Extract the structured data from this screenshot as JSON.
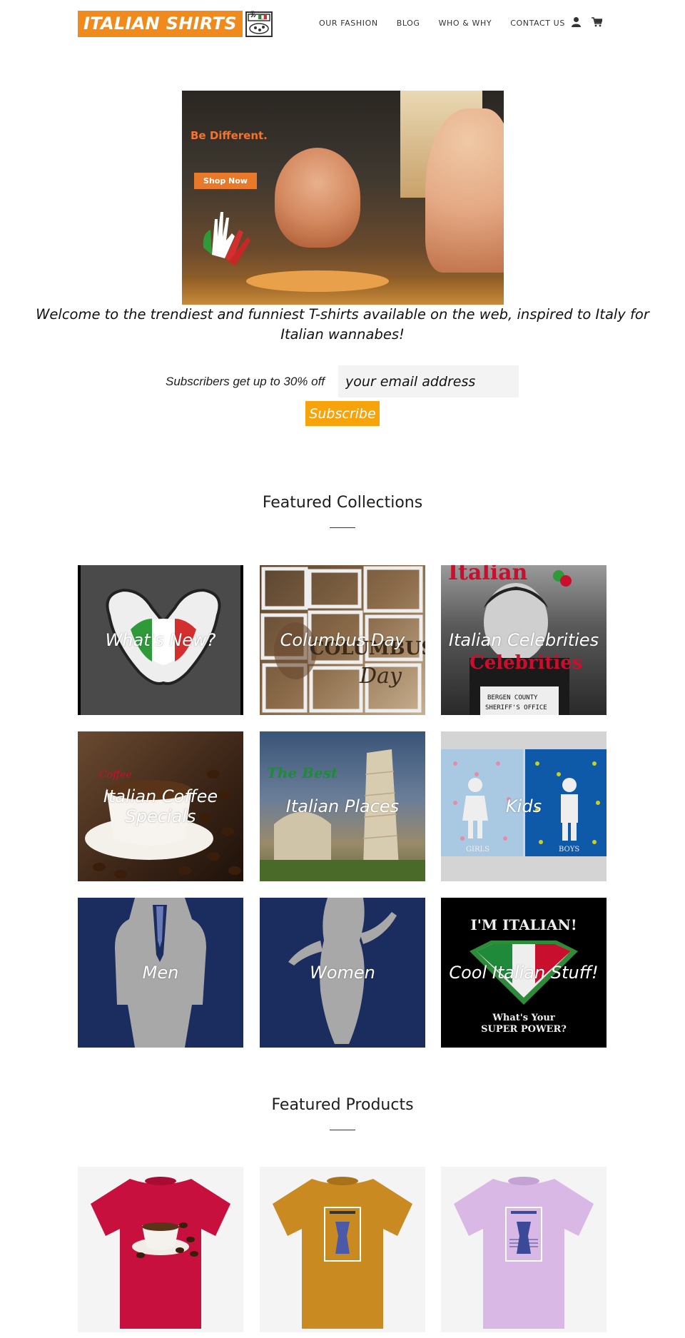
{
  "header": {
    "logo_text": "ITALIAN SHIRTS",
    "logo_reg": "®",
    "nav": [
      "OUR FASHION",
      "BLOG",
      "WHO & WHY",
      "CONTACT US"
    ],
    "icons": [
      "account-icon",
      "cart-icon"
    ]
  },
  "hero": {
    "tagline": "Be Different.",
    "button": "Shop Now"
  },
  "welcome": "Welcome to the trendiest and funniest T-shirts available on the web, inspired to Italy for Italian wannabes!",
  "subscribe": {
    "label": "Subscribers get up to 30% off",
    "placeholder": "your email address",
    "button": "Subscribe"
  },
  "featured_collections": {
    "title": "Featured Collections",
    "items": [
      {
        "label": "What's New?"
      },
      {
        "label": "Columbus Day"
      },
      {
        "label": "Italian Celebrities"
      },
      {
        "label": "Italian Coffee Specials"
      },
      {
        "label": "Italian Places"
      },
      {
        "label": "Kids"
      },
      {
        "label": "Men"
      },
      {
        "label": "Women"
      },
      {
        "label": "Cool Italian Stuff!"
      }
    ]
  },
  "featured_products": {
    "title": "Featured Products",
    "items": [
      {
        "color": "#c8103e"
      },
      {
        "color": "#c98a22"
      },
      {
        "color": "#d9b8e6"
      }
    ]
  },
  "colors": {
    "brand_orange": "#f08a1c",
    "subscribe_button": "#f7a30c",
    "navy": "#1b2d5e"
  }
}
